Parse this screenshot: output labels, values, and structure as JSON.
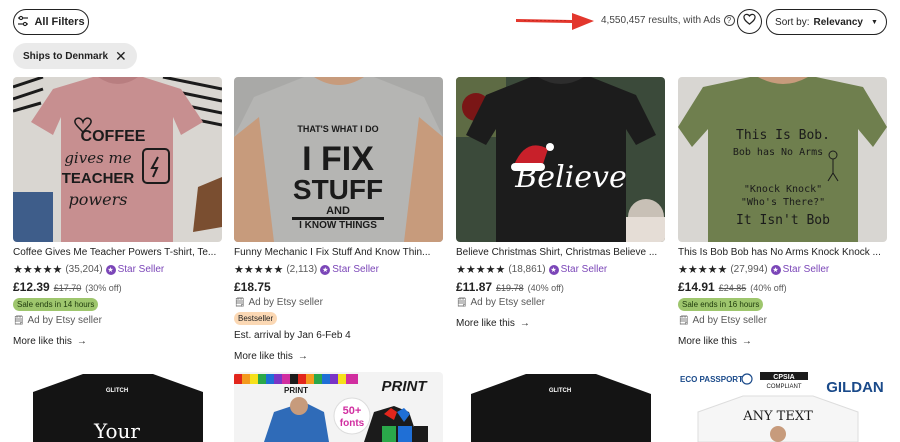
{
  "toolbar": {
    "filters_label": "All Filters",
    "results_text": "4,550,457 results, with Ads",
    "sort_label": "Sort by:",
    "sort_value": "Relevancy",
    "chip_label": "Ships to Denmark"
  },
  "colors": {
    "star_seller": "#7b46b8",
    "sale_badge": "#9ec66d",
    "bestseller_badge": "#fbd8b4",
    "annotation_arrow": "#e3372d"
  },
  "listings": [
    {
      "title": "Coffee Gives Me Teacher Powers T-shirt, Te...",
      "stars": "★★★★★",
      "count": "(35,204)",
      "star_seller": "Star Seller",
      "price": "£12.39",
      "original": "£17.70",
      "discount": "(30% off)",
      "badge": "Sale ends in 14 hours",
      "ad": "Ad by Etsy seller",
      "more": "More like this",
      "shirt_text": [
        "COFFEE",
        "gives me",
        "TEACHER",
        "powers"
      ]
    },
    {
      "title": "Funny Mechanic I Fix Stuff And Know Thin...",
      "stars": "★★★★★",
      "count": "(2,113)",
      "star_seller": "Star Seller",
      "price": "£18.75",
      "ad": "Ad by Etsy seller",
      "badge": "Bestseller",
      "arrival": "Est. arrival by Jan 6-Feb 4",
      "more": "More like this",
      "shirt_text": [
        "THAT'S WHAT I DO",
        "I FIX",
        "STUFF",
        "AND",
        "I KNOW THINGS"
      ]
    },
    {
      "title": "Believe Christmas Shirt, Christmas Believe ...",
      "stars": "★★★★★",
      "count": "(18,861)",
      "star_seller": "Star Seller",
      "price": "£11.87",
      "original": "£19.78",
      "discount": "(40% off)",
      "ad": "Ad by Etsy seller",
      "more": "More like this",
      "shirt_text": [
        "Believe"
      ]
    },
    {
      "title": "This Is Bob Bob has No Arms Knock Knock ...",
      "stars": "★★★★★",
      "count": "(27,994)",
      "star_seller": "Star Seller",
      "price": "£14.91",
      "original": "£24.85",
      "discount": "(40% off)",
      "badge": "Sale ends in 16 hours",
      "ad": "Ad by Etsy seller",
      "more": "More like this",
      "shirt_text": [
        "This Is Bob.",
        "Bob has No Arms",
        "\"Knock Knock\"",
        "\"Who's There?\"",
        "It Isn't Bob"
      ]
    }
  ],
  "row2": {
    "card1_text": [
      "GLITCH",
      "Your"
    ],
    "card2_text": [
      "PRINT",
      "PRINT",
      "50+",
      "fonts"
    ],
    "card3_text": [
      "GLITCH"
    ],
    "card4_text": [
      "ECO PASSPORT",
      "CPSIA",
      "COMPLIANT",
      "GILDAN",
      "ANY TEXT"
    ]
  }
}
